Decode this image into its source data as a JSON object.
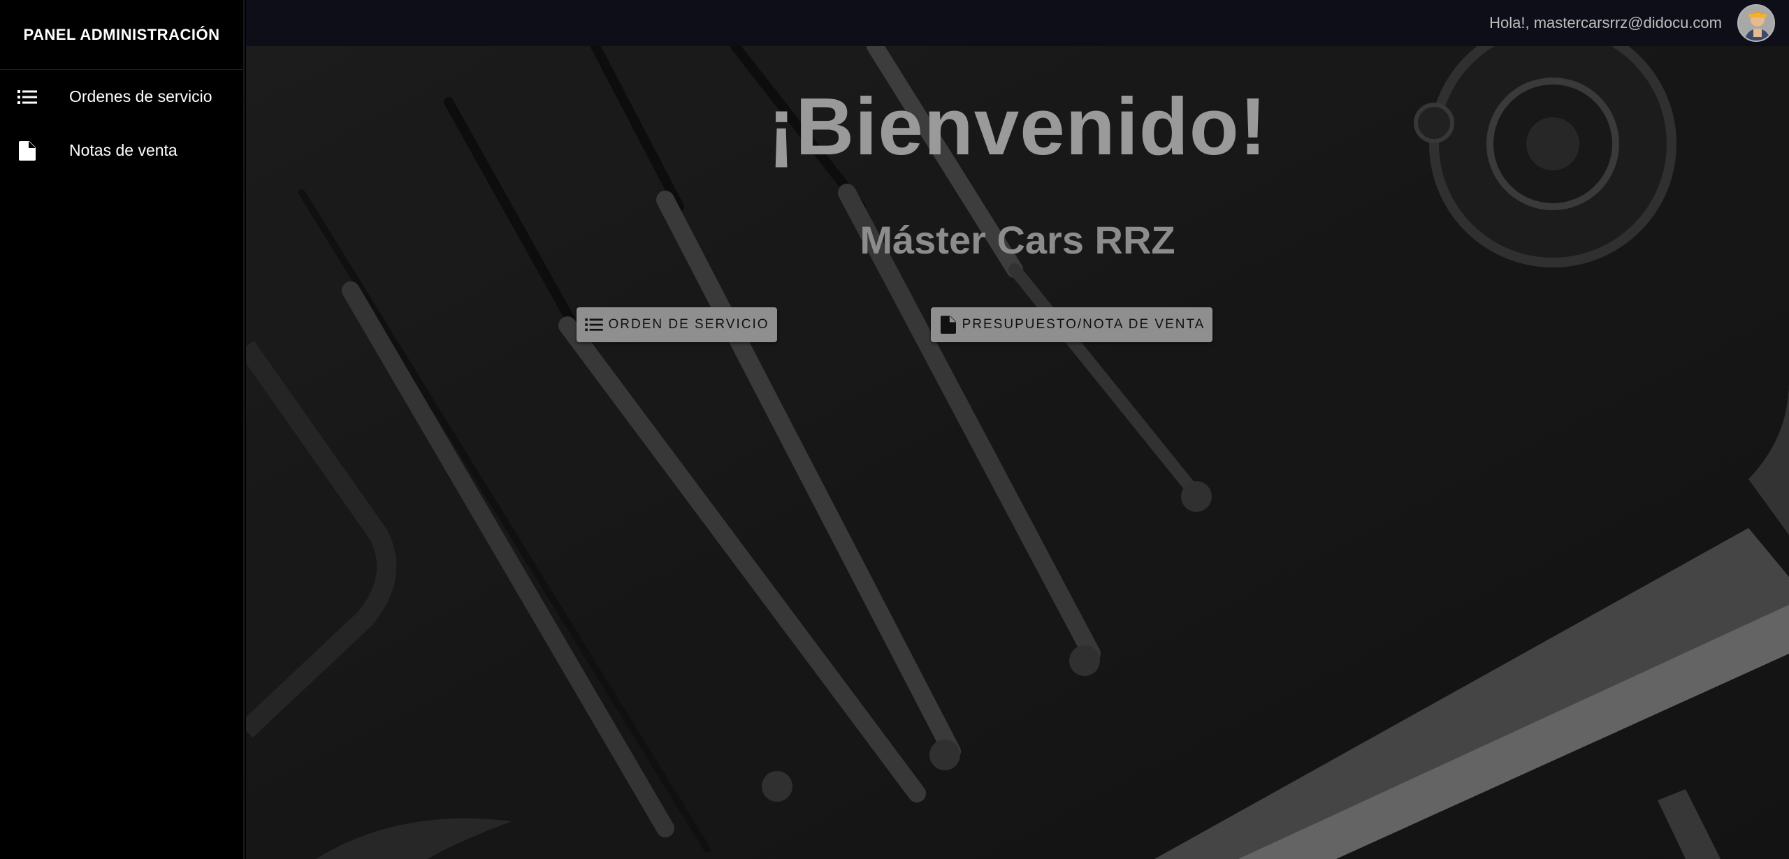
{
  "sidebar": {
    "title": "PANEL ADMINISTRACIÓN",
    "items": [
      {
        "label": "Ordenes de servicio",
        "icon": "list-icon"
      },
      {
        "label": "Notas de venta",
        "icon": "document-icon"
      }
    ]
  },
  "topbar": {
    "greeting": "Hola!, mastercarsrrz@didocu.com",
    "avatar_icon": "user-avatar"
  },
  "hero": {
    "title": "¡Bienvenido!",
    "subtitle": "Máster Cars RRZ",
    "buttons": {
      "orden": {
        "label": "ORDEN DE SERVICIO",
        "icon": "list-icon"
      },
      "presupuesto": {
        "label": "PRESUPUESTO/NOTA DE VENTA",
        "icon": "document-icon"
      }
    }
  },
  "colors": {
    "sidebar_bg": "#000000",
    "topbar_bg": "#0d0e18",
    "hero_text": "#9a9a9a",
    "button_bg": "#8f8f8f"
  }
}
